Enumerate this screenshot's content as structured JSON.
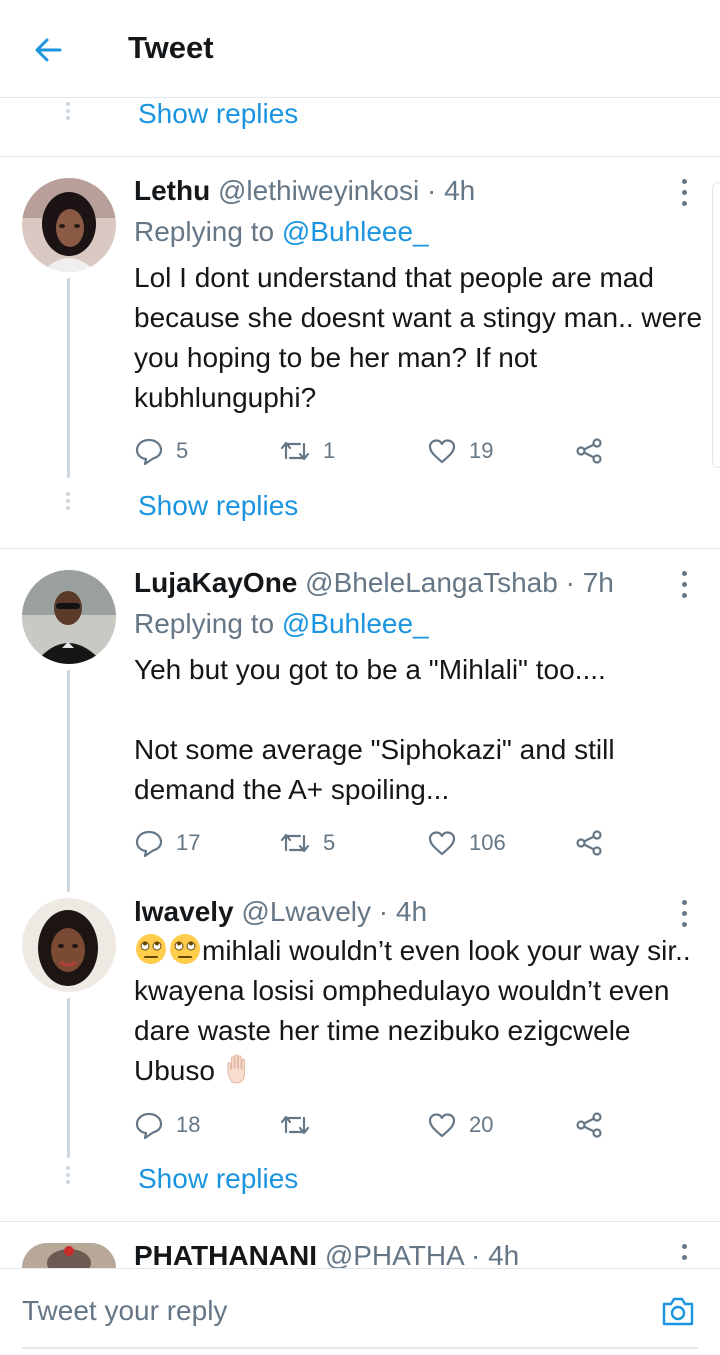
{
  "header": {
    "title": "Tweet",
    "back_icon": "arrow-left-icon"
  },
  "colors": {
    "accent": "#1b95e0",
    "muted": "#657786",
    "text": "#14171a",
    "divider": "#e1e8ed"
  },
  "show_replies_label": "Show replies",
  "tweets": [
    {
      "name": "Lethu",
      "handle": "@lethiweyinkosi",
      "time": "4h",
      "replying_prefix": "Replying to",
      "replying_to": "@Buhleee_",
      "text": "Lol I dont understand that people are mad because she doesnt want a stingy man.. were you hoping to be her man? If not kubhlunguphi?",
      "replies": "5",
      "retweets": "1",
      "likes": "19"
    },
    {
      "name": "LujaKayOne",
      "handle": "@BheleLangaTshab",
      "time": "7h",
      "replying_prefix": "Replying to",
      "replying_to": "@Buhleee_",
      "text": "Yeh but you got to be a \"Mihlali\" too....\n\nNot some average \"Siphokazi\" and still demand the A+ spoiling...",
      "replies": "17",
      "retweets": "5",
      "likes": "106"
    },
    {
      "name": "lwavely",
      "handle": "@Lwavely",
      "time": "4h",
      "text": "mihlali wouldn’t even look your way sir.. kwayena losisi omphedulayo wouldn’t even dare waste her time nezibuko ezigcwele Ubuso",
      "emoji_lead": [
        "face-with-rolling-eyes",
        "face-with-rolling-eyes"
      ],
      "emoji_trail": "raised-hand",
      "replies": "18",
      "retweets": "",
      "likes": "20"
    },
    {
      "name": "PHATHANANI",
      "handle": "@PHATHA",
      "time": "4h"
    }
  ],
  "composer": {
    "placeholder": "Tweet your reply",
    "camera_icon": "camera-icon"
  }
}
